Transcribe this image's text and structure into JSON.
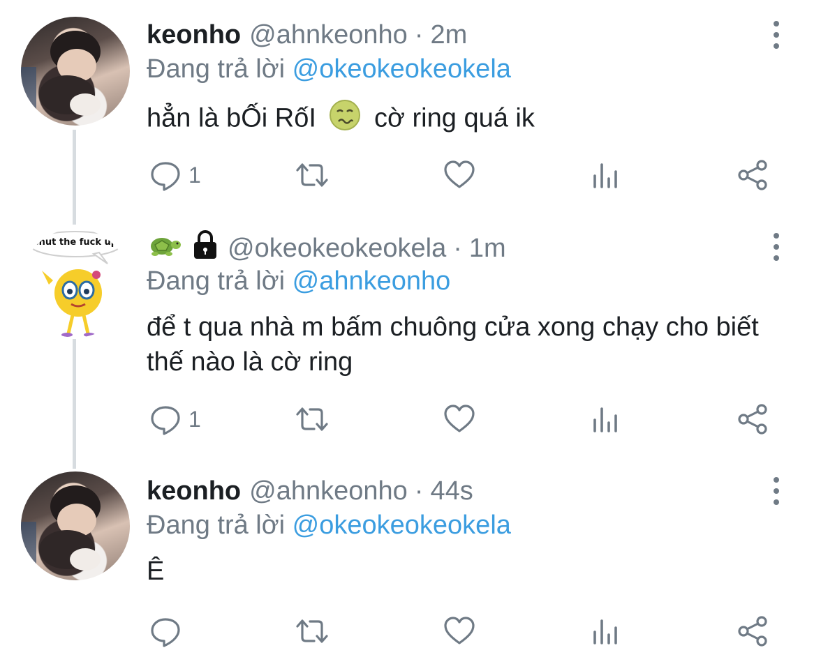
{
  "colors": {
    "link": "#3b9de0",
    "muted": "#6f7a85",
    "text": "#1b1f23",
    "thread_line": "#d7dce0"
  },
  "tweets": [
    {
      "name": "keonho",
      "handle": "@ahnkeonho",
      "separator": "·",
      "time": "2m",
      "replying_label": "Đang trả lời",
      "replying_to": "@okeokeokeokela",
      "text_before_emoji": "hẳn là bỐi RốI",
      "emoji": "nauseated-face-emoji",
      "text_after_emoji": "cờ ring quá ik",
      "reply_count": "1",
      "avatar": "profile-photo"
    },
    {
      "name_icons": [
        "turtle-emoji",
        "lock-emoji"
      ],
      "handle": "@okeokeokeokela",
      "separator": "·",
      "time": "1m",
      "replying_label": "Đang trả lời",
      "replying_to": "@ahnkeonho",
      "text": "để t qua nhà m bấm chuông cửa xong chạy cho biết thế nào là cờ ring",
      "reply_count": "1",
      "avatar": "meme-avatar",
      "avatar_caption": "shut the fuck up"
    },
    {
      "name": "keonho",
      "handle": "@ahnkeonho",
      "separator": "·",
      "time": "44s",
      "replying_label": "Đang trả lời",
      "replying_to": "@okeokeokeokela",
      "text": "Ê",
      "reply_count": "",
      "avatar": "profile-photo"
    }
  ],
  "action_icons": [
    "reply-icon",
    "retweet-icon",
    "like-icon",
    "views-icon",
    "share-icon"
  ]
}
